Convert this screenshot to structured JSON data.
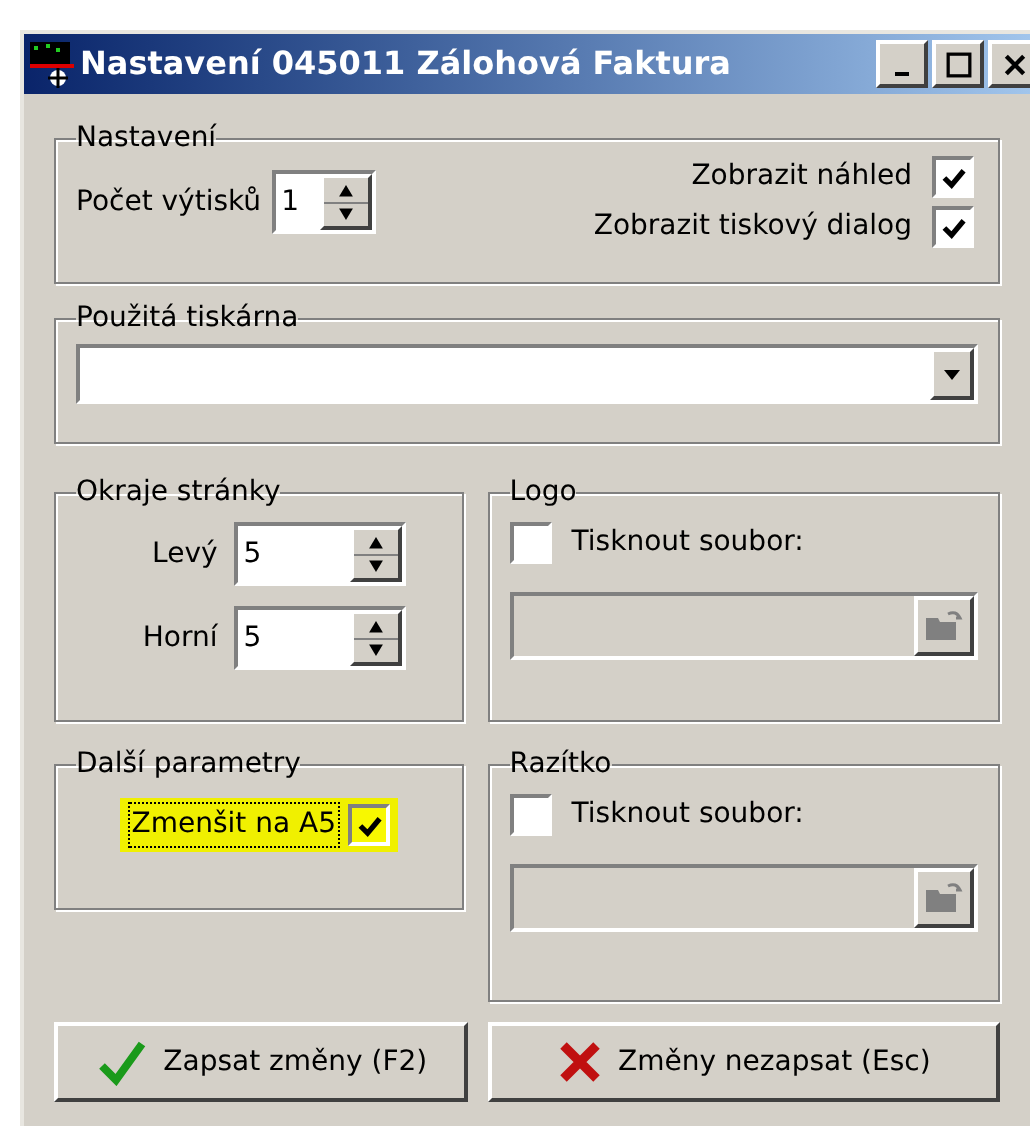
{
  "window": {
    "title": "Nastavení 045011 Zálohová Faktura"
  },
  "settings": {
    "label": "Nastavení",
    "copies": {
      "label": "Počet výtisků",
      "value": "1"
    },
    "options": [
      {
        "label": "Zobrazit náhled",
        "checked": true
      },
      {
        "label": "Zobrazit tiskový dialog",
        "checked": true
      }
    ]
  },
  "printer": {
    "label": "Použitá tiskárna"
  },
  "margins": {
    "label": "Okraje stránky",
    "fields": [
      {
        "label": "Levý",
        "value": "5"
      },
      {
        "label": "Horní",
        "value": "5"
      }
    ]
  },
  "more": {
    "label": "Další parametry",
    "option": {
      "label": "Zmenšit na A5",
      "checked": true,
      "highlighted": true
    }
  },
  "file_groups": [
    {
      "label": "Logo",
      "checkbox": {
        "label": "Tisknout soubor:",
        "checked": false
      }
    },
    {
      "label": "Razítko",
      "checkbox": {
        "label": "Tisknout soubor:",
        "checked": false
      }
    }
  ],
  "buttons": [
    {
      "label": "Zapsat změny (F2)",
      "kind": "save"
    },
    {
      "label": "Změny nezapsat (Esc)",
      "kind": "cancel"
    }
  ]
}
